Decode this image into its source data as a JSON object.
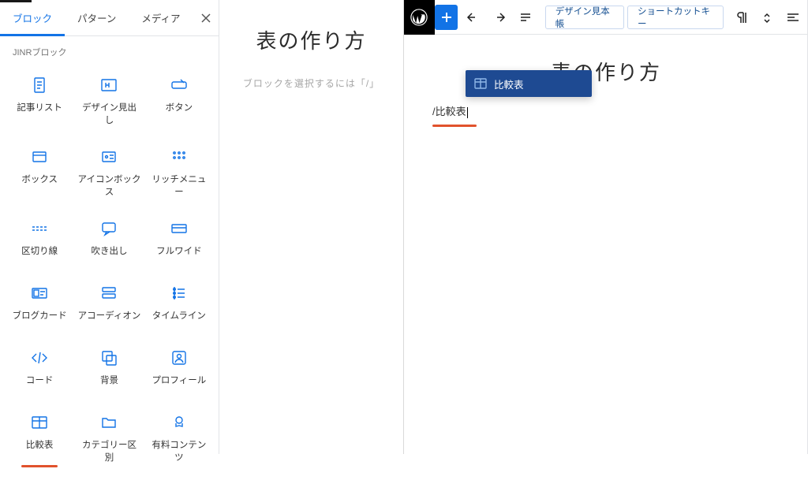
{
  "left": {
    "tabs": [
      "ブロック",
      "パターン",
      "メディア"
    ],
    "activeTab": 0,
    "sectionLabel": "JINRブロック",
    "blocks": [
      {
        "label": "記事リスト",
        "icon": "doc"
      },
      {
        "label": "デザイン見出し",
        "icon": "heading"
      },
      {
        "label": "ボタン",
        "icon": "button"
      },
      {
        "label": "ボックス",
        "icon": "box"
      },
      {
        "label": "アイコンボックス",
        "icon": "iconbox"
      },
      {
        "label": "リッチメニュー",
        "icon": "richmenu"
      },
      {
        "label": "区切り線",
        "icon": "divider"
      },
      {
        "label": "吹き出し",
        "icon": "speech"
      },
      {
        "label": "フルワイド",
        "icon": "fullwide"
      },
      {
        "label": "ブログカード",
        "icon": "card"
      },
      {
        "label": "アコーディオン",
        "icon": "accordion"
      },
      {
        "label": "タイムライン",
        "icon": "timeline"
      },
      {
        "label": "コード",
        "icon": "code"
      },
      {
        "label": "背景",
        "icon": "bg"
      },
      {
        "label": "プロフィール",
        "icon": "profile"
      },
      {
        "label": "比較表",
        "icon": "table",
        "highlight": true
      },
      {
        "label": "カテゴリー区別",
        "icon": "folder"
      },
      {
        "label": "有料コンテンツ",
        "icon": "paid"
      }
    ],
    "preview": {
      "title": "表の作り方",
      "hint": "ブロックを選択するには「/」"
    }
  },
  "right": {
    "toolbar": {
      "designBtn": "デザイン見本帳",
      "shortcutBtn": "ショートカットキー"
    },
    "docTitle": "表の作り方",
    "slashText": "/比較表",
    "suggestionLabel": "比較表"
  }
}
